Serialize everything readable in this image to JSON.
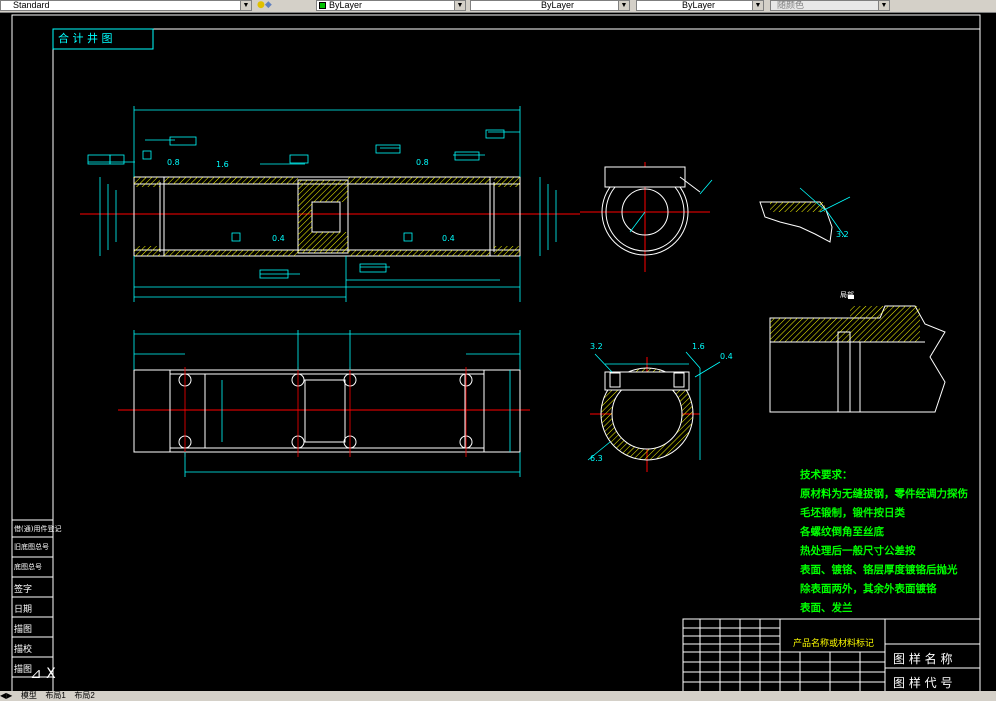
{
  "toolbar": {
    "text_style": "Standard",
    "color": "ByLayer",
    "linetype": "ByLayer",
    "lineweight": "ByLayer",
    "plotstyle": "随颜色"
  },
  "drawing": {
    "assembly_tag": "合  计  井  图",
    "notes_title": "技术要求：",
    "notes": [
      "原材料为无缝拔钢，零件经调力探伤",
      "毛坯锻制，锻件按日类",
      "各螺纹倒角至丝底",
      "热处理后一般尺寸公差按",
      "表面、镀铬、铬层厚度镀铬后抛光",
      "除表面两外，其余外表面镀铬",
      "表面、发兰"
    ],
    "left_strip": [
      "借(通)用件登记",
      "旧底图总号",
      "底图总号",
      "签字",
      "日期",
      "描图",
      "描校",
      "描图"
    ],
    "title_block": {
      "product_line": "产品名称或材料标记",
      "drawing_name": "图 样 名 称",
      "drawing_code": "图 样 代 号"
    },
    "view_label_detail": "局部",
    "roughness_values": [
      "0.8",
      "0.8",
      "0.4",
      "0.4",
      "1.6",
      "3.2",
      "1.6",
      "0.4",
      "6.3",
      "3.2"
    ]
  },
  "layout_tabs": [
    "模型",
    "布局1",
    "布局2"
  ],
  "colors": {
    "bg": "#000000",
    "line": "#ffffff",
    "dim": "#00ffff",
    "center": "#ff0000",
    "hatch": "#ffff00",
    "note": "#00ff00"
  }
}
